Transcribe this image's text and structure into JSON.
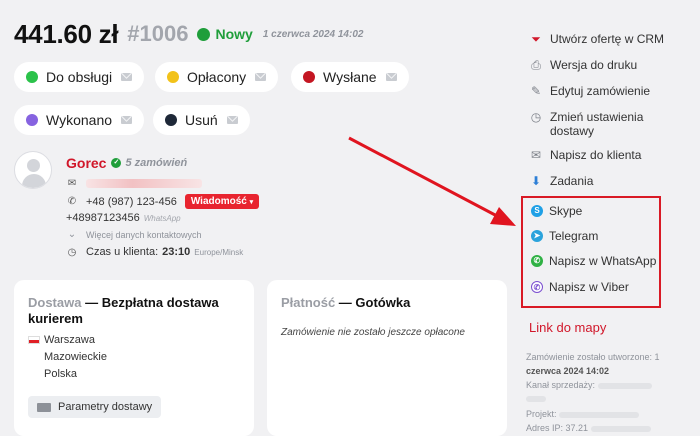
{
  "header": {
    "amount": "441.60 zł",
    "order_no": "#1006",
    "status": "Nowy",
    "date": "1 czerwca 2024 14:02"
  },
  "colors": {
    "new": "#1f9e3a",
    "accent_red": "#d1172a",
    "do_obslugi": "#2bc24a",
    "oplacony": "#f2c21a",
    "wyslane": "#c41622",
    "wykonano": "#8663e0",
    "usun": "#1e2838"
  },
  "status_chips": [
    {
      "label": "Do obsługi",
      "color": "#2bc24a"
    },
    {
      "label": "Opłacony",
      "color": "#f2c21a"
    },
    {
      "label": "Wysłane",
      "color": "#c41622"
    },
    {
      "label": "Wykonano",
      "color": "#8663e0"
    },
    {
      "label": "Usuń",
      "color": "#1e2838"
    }
  ],
  "customer": {
    "name": "Gorec",
    "orders": "5 zamówień",
    "phone": "+48 (987) 123-456",
    "message_btn": "Wiadomość",
    "whatsapp_phone": "+48987123456",
    "whatsapp_label": "WhatsApp",
    "more_contacts": "Więcej danych kontaktowych",
    "time_label": "Czas u klienta:",
    "time": "23:10",
    "timezone": "Europe/Minsk"
  },
  "delivery": {
    "label": "Dostawa",
    "sep": " — ",
    "value": "Bezpłatna dostawa kurierem",
    "city": "Warszawa",
    "region": "Mazowieckie",
    "country": "Polska",
    "params_btn": "Parametry dostawy"
  },
  "payment": {
    "label": "Płatność",
    "sep": " — ",
    "value": "Gotówka",
    "note": "Zamówienie nie zostało jeszcze opłacone"
  },
  "sidebar": {
    "actions": [
      "Utwórz ofertę w CRM",
      "Wersja do druku",
      "Edytuj zamówienie",
      "Zmień ustawienia",
      "dostawy",
      "Napisz do klienta",
      "Zadania"
    ],
    "messengers": [
      "Skype",
      "Telegram",
      "Napisz w WhatsApp",
      "Napisz w Viber"
    ],
    "map_link": "Link do mapy",
    "meta": {
      "created_1": "Zamówienie zostało utworzone: 1",
      "created_2": "czerwca 2024 14:02",
      "channel": "Kanał sprzedaży:",
      "project": "Projekt:",
      "ip": "Adres IP: 37.21"
    }
  }
}
